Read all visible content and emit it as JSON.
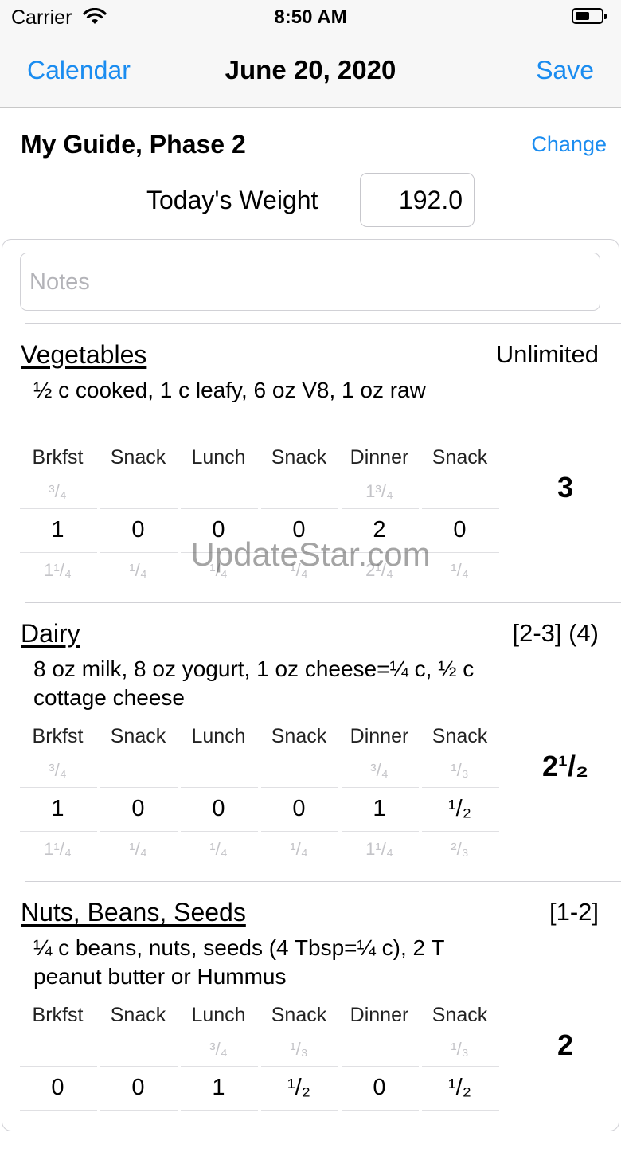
{
  "status_bar": {
    "carrier": "Carrier",
    "time": "8:50 AM"
  },
  "nav": {
    "back_label": "Calendar",
    "title": "June 20, 2020",
    "save_label": "Save"
  },
  "guide": {
    "title": "My Guide, Phase 2",
    "change_label": "Change"
  },
  "weight": {
    "label": "Today's Weight",
    "value": "192.0"
  },
  "notes": {
    "placeholder": "Notes"
  },
  "meals": [
    "Brkfst",
    "Snack",
    "Lunch",
    "Snack",
    "Dinner",
    "Snack"
  ],
  "sections": [
    {
      "name": "Vegetables",
      "servings": "Unlimited",
      "description": "½ c cooked, 1 c leafy, 6 oz V8, 1 oz raw",
      "above": [
        "³/₄",
        "",
        "",
        "",
        "1³/₄",
        ""
      ],
      "current": [
        "1",
        "0",
        "0",
        "0",
        "2",
        "0"
      ],
      "below": [
        "1¹/₄",
        "¹/₄",
        "¹/₄",
        "¹/₄",
        "2¹/₄",
        "¹/₄"
      ],
      "total": "3"
    },
    {
      "name": "Dairy",
      "servings": "[2-3] (4)",
      "description": "8 oz milk, 8 oz yogurt, 1 oz cheese=¼ c, ½ c cottage cheese",
      "above": [
        "³/₄",
        "",
        "",
        "",
        "³/₄",
        "¹/₃"
      ],
      "current": [
        "1",
        "0",
        "0",
        "0",
        "1",
        "¹/₂"
      ],
      "below": [
        "1¹/₄",
        "¹/₄",
        "¹/₄",
        "¹/₄",
        "1¹/₄",
        "²/₃"
      ],
      "total": "2¹/₂"
    },
    {
      "name": "Nuts, Beans, Seeds",
      "servings": "[1-2]",
      "description": "¼ c beans, nuts, seeds (4 Tbsp=¼ c), 2 T peanut butter or Hummus",
      "above": [
        "",
        "",
        "³/₄",
        "¹/₃",
        "",
        "¹/₃"
      ],
      "current": [
        "0",
        "0",
        "1",
        "¹/₂",
        "0",
        "¹/₂"
      ],
      "below": [
        "",
        "",
        "",
        "",
        "",
        ""
      ],
      "total": "2"
    }
  ],
  "watermark": "UpdateStar.com"
}
